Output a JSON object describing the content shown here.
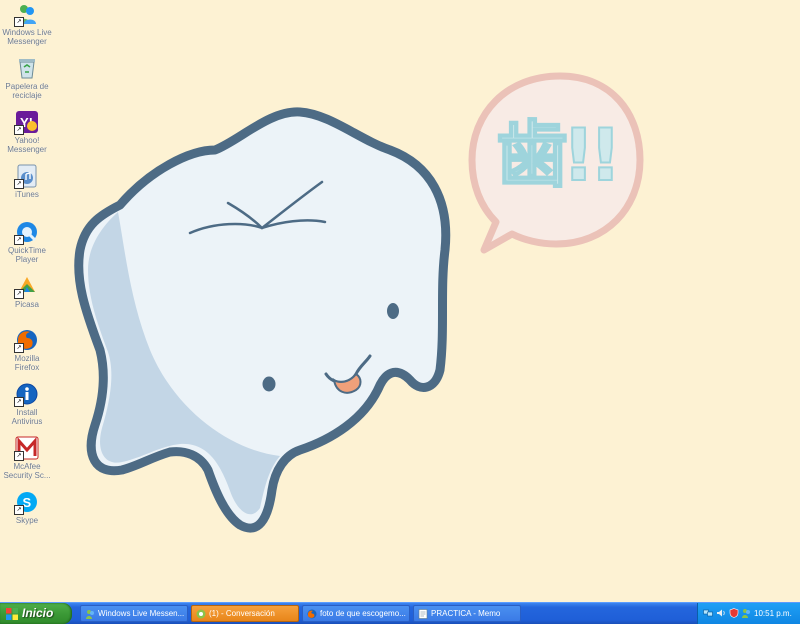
{
  "desktop": {
    "background": "#fdf2d3",
    "icons": [
      {
        "label": "Windows Live Messenger",
        "icon": "messenger-icon"
      },
      {
        "label": "Papelera de reciclaje",
        "icon": "recycle-bin-icon"
      },
      {
        "label": "Yahoo! Messenger",
        "icon": "yahoo-messenger-icon"
      },
      {
        "label": "iTunes",
        "icon": "itunes-icon"
      },
      {
        "label": "QuickTime Player",
        "icon": "quicktime-icon"
      },
      {
        "label": "Picasa",
        "icon": "picasa-icon"
      },
      {
        "label": "Mozilla Firefox",
        "icon": "firefox-icon"
      },
      {
        "label": "Install Antivirus",
        "icon": "antivirus-icon"
      },
      {
        "label": "McAfee Security Sc...",
        "icon": "mcafee-icon"
      },
      {
        "label": "Skype",
        "icon": "skype-icon"
      }
    ]
  },
  "wallpaper": {
    "bubble_text": "歯!!",
    "tooth_outline": "#4d6b85",
    "tooth_fill": "#ecf3f8",
    "tooth_shadow": "#c3d6e6",
    "bubble_ring": "#ebc2b8",
    "bubble_fill": "#f8ebe5"
  },
  "taskbar": {
    "start_label": "Inicio",
    "tasks": [
      {
        "label": "Windows Live Messen...",
        "icon": "messenger-icon",
        "active": false
      },
      {
        "label": "(1) - Conversación",
        "icon": "chat-icon",
        "active": true
      },
      {
        "label": "foto de que escogemo...",
        "icon": "firefox-icon",
        "active": false
      },
      {
        "label": "PRACTICA - Memo",
        "icon": "notepad-icon",
        "active": false
      }
    ],
    "tray": {
      "clock": "10:51 p.m.",
      "icons": [
        "network-icon",
        "volume-icon",
        "security-icon",
        "messenger-tray-icon"
      ]
    }
  }
}
